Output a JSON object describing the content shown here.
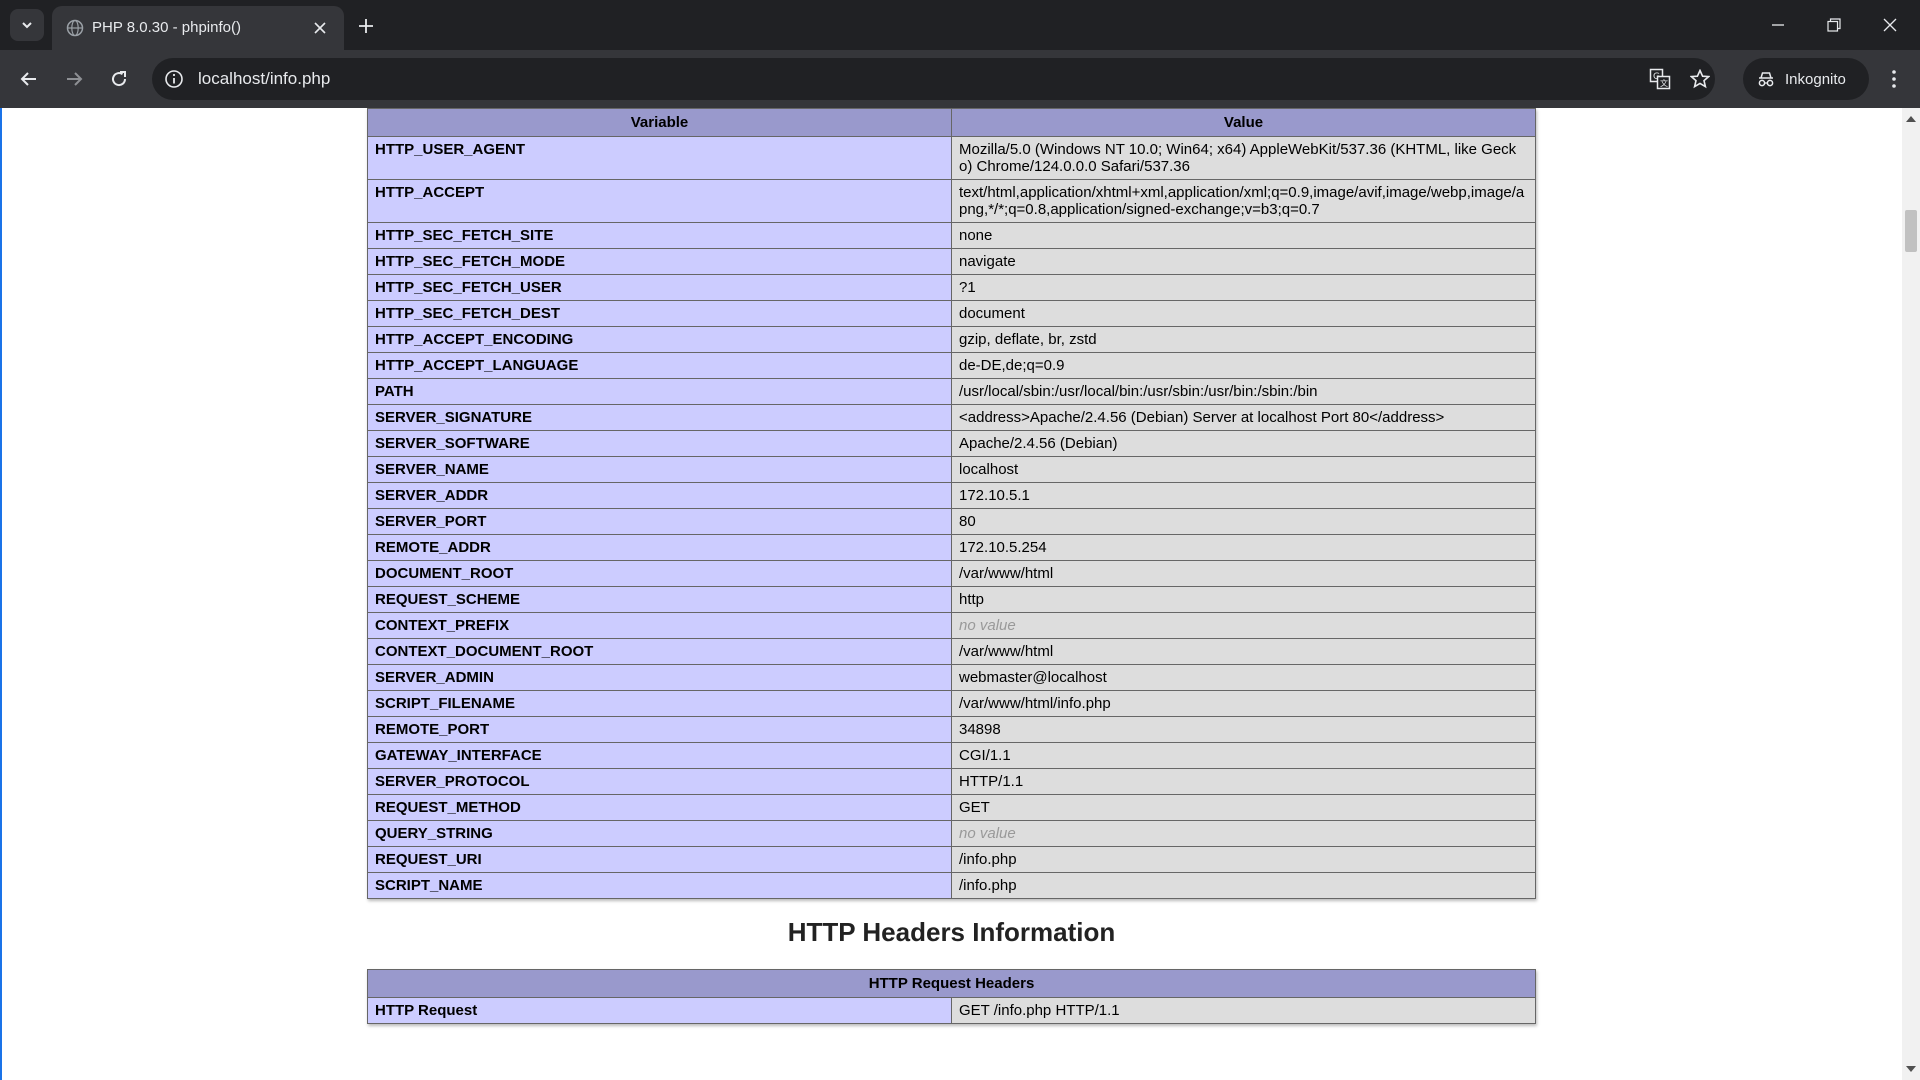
{
  "browser": {
    "tab_title": "PHP 8.0.30 - phpinfo()",
    "url": "localhost/info.php",
    "profile_label": "Inkognito"
  },
  "icons": {
    "tab_search": "chevron-down-icon",
    "favicon": "globe-icon",
    "tab_close": "close-icon",
    "new_tab": "plus-icon",
    "minimize": "minimize-icon",
    "restore": "restore-icon",
    "close_window": "close-icon",
    "back": "arrow-left-icon",
    "forward": "arrow-right-icon",
    "reload": "reload-icon",
    "site_info": "info-icon",
    "translate": "translate-icon",
    "bookmark": "star-icon",
    "incognito": "incognito-icon",
    "menu": "kebab-menu-icon"
  },
  "colors": {
    "header_bg": "#9999cc",
    "key_bg": "#ccccff",
    "value_bg": "#dddddd",
    "no_value": "#999999"
  },
  "apache_env": {
    "headers": [
      "Variable",
      "Value"
    ],
    "rows": [
      {
        "k": "HTTP_USER_AGENT",
        "v": "Mozilla/5.0 (Windows NT 10.0; Win64; x64) AppleWebKit/537.36 (KHTML, like Gecko) Chrome/124.0.0.0 Safari/537.36"
      },
      {
        "k": "HTTP_ACCEPT",
        "v": "text/html,application/xhtml+xml,application/xml;q=0.9,image/avif,image/webp,image/apng,*/*;q=0.8,application/signed-exchange;v=b3;q=0.7"
      },
      {
        "k": "HTTP_SEC_FETCH_SITE",
        "v": "none"
      },
      {
        "k": "HTTP_SEC_FETCH_MODE",
        "v": "navigate"
      },
      {
        "k": "HTTP_SEC_FETCH_USER",
        "v": "?1"
      },
      {
        "k": "HTTP_SEC_FETCH_DEST",
        "v": "document"
      },
      {
        "k": "HTTP_ACCEPT_ENCODING",
        "v": "gzip, deflate, br, zstd"
      },
      {
        "k": "HTTP_ACCEPT_LANGUAGE",
        "v": "de-DE,de;q=0.9"
      },
      {
        "k": "PATH",
        "v": "/usr/local/sbin:/usr/local/bin:/usr/sbin:/usr/bin:/sbin:/bin"
      },
      {
        "k": "SERVER_SIGNATURE",
        "v": "<address>Apache/2.4.56 (Debian) Server at localhost Port 80</address>"
      },
      {
        "k": "SERVER_SOFTWARE",
        "v": "Apache/2.4.56 (Debian)"
      },
      {
        "k": "SERVER_NAME",
        "v": "localhost"
      },
      {
        "k": "SERVER_ADDR",
        "v": "172.10.5.1"
      },
      {
        "k": "SERVER_PORT",
        "v": "80"
      },
      {
        "k": "REMOTE_ADDR",
        "v": "172.10.5.254"
      },
      {
        "k": "DOCUMENT_ROOT",
        "v": "/var/www/html"
      },
      {
        "k": "REQUEST_SCHEME",
        "v": "http"
      },
      {
        "k": "CONTEXT_PREFIX",
        "v": "no value",
        "nv": true
      },
      {
        "k": "CONTEXT_DOCUMENT_ROOT",
        "v": "/var/www/html"
      },
      {
        "k": "SERVER_ADMIN",
        "v": "webmaster@localhost"
      },
      {
        "k": "SCRIPT_FILENAME",
        "v": "/var/www/html/info.php"
      },
      {
        "k": "REMOTE_PORT",
        "v": "34898"
      },
      {
        "k": "GATEWAY_INTERFACE",
        "v": "CGI/1.1"
      },
      {
        "k": "SERVER_PROTOCOL",
        "v": "HTTP/1.1"
      },
      {
        "k": "REQUEST_METHOD",
        "v": "GET"
      },
      {
        "k": "QUERY_STRING",
        "v": "no value",
        "nv": true
      },
      {
        "k": "REQUEST_URI",
        "v": "/info.php"
      },
      {
        "k": "SCRIPT_NAME",
        "v": "/info.php"
      }
    ]
  },
  "http_headers": {
    "section_title": "HTTP Headers Information",
    "table_header": "HTTP Request Headers",
    "rows": [
      {
        "k": "HTTP Request",
        "v": "GET /info.php HTTP/1.1"
      }
    ]
  }
}
